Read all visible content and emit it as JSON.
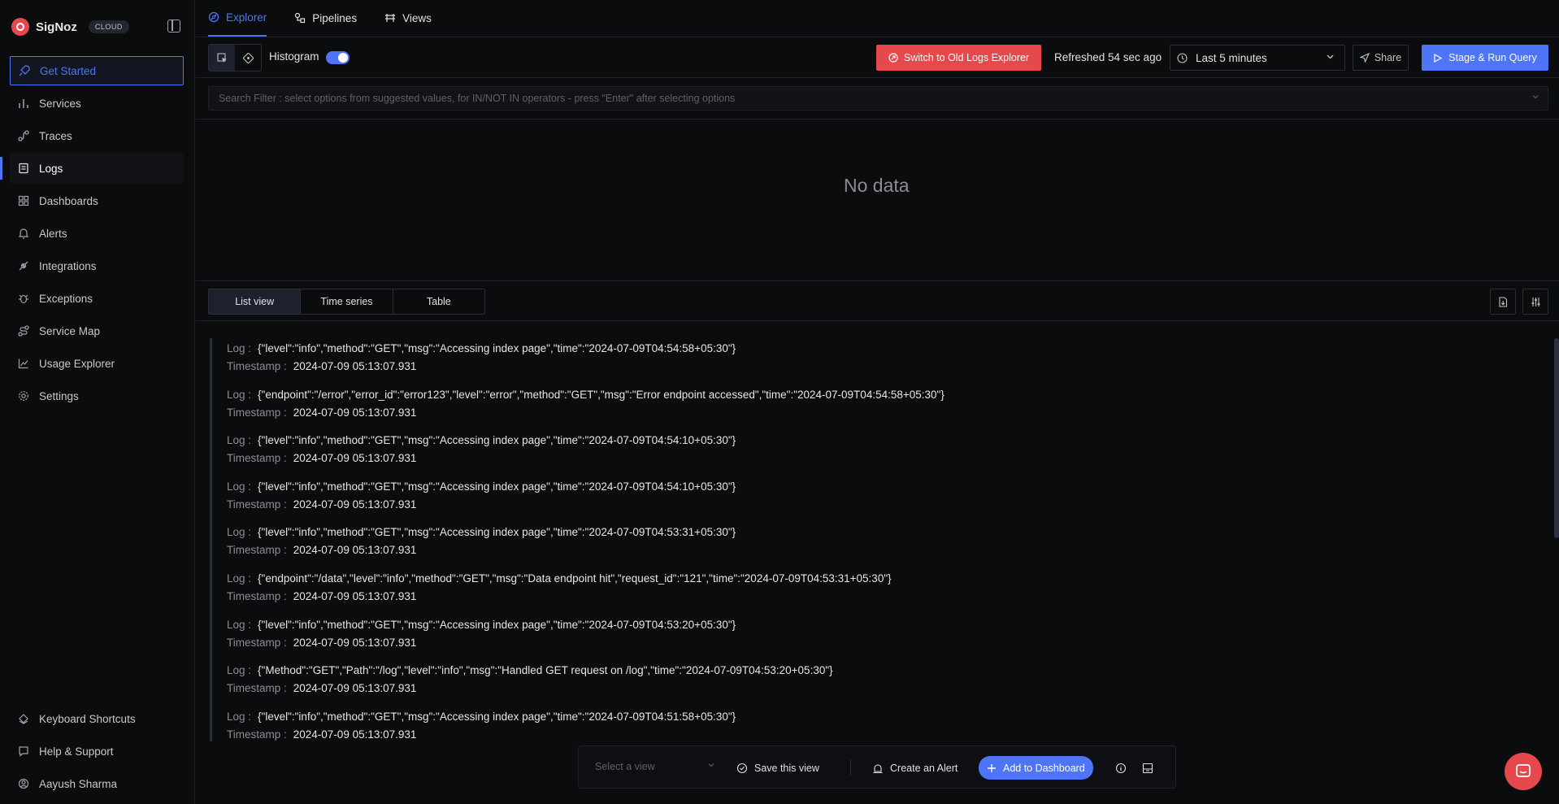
{
  "brand": {
    "name": "SigNoz",
    "badge": "CLOUD"
  },
  "sidebar": {
    "items": [
      {
        "label": "Get Started",
        "icon": "rocket-icon"
      },
      {
        "label": "Services",
        "icon": "bar-chart-icon"
      },
      {
        "label": "Traces",
        "icon": "route-icon"
      },
      {
        "label": "Logs",
        "icon": "logs-icon"
      },
      {
        "label": "Dashboards",
        "icon": "grid-icon"
      },
      {
        "label": "Alerts",
        "icon": "bell-icon"
      },
      {
        "label": "Integrations",
        "icon": "plug-icon"
      },
      {
        "label": "Exceptions",
        "icon": "bug-icon"
      },
      {
        "label": "Service Map",
        "icon": "route-icon"
      },
      {
        "label": "Usage Explorer",
        "icon": "line-chart-icon"
      },
      {
        "label": "Settings",
        "icon": "gear-icon"
      }
    ],
    "bottom": [
      {
        "label": "Keyboard Shortcuts",
        "icon": "keyboard-icon"
      },
      {
        "label": "Help & Support",
        "icon": "help-icon"
      },
      {
        "label": "Aayush Sharma",
        "icon": "user-icon"
      }
    ]
  },
  "top_tabs": [
    {
      "label": "Explorer",
      "icon": "compass-icon"
    },
    {
      "label": "Pipelines",
      "icon": "pipeline-icon"
    },
    {
      "label": "Views",
      "icon": "views-icon"
    }
  ],
  "toolbar": {
    "histogram_label": "Histogram",
    "switch_old": "Switch to Old Logs Explorer",
    "refreshed": "Refreshed 54 sec ago",
    "time_range": "Last 5 minutes",
    "share": "Share",
    "stage_run": "Stage & Run Query"
  },
  "search": {
    "placeholder": "Search Filter : select options from suggested values, for IN/NOT IN operators - press \"Enter\" after selecting options"
  },
  "histogram": {
    "empty_text": "No data"
  },
  "view_tabs": [
    "List view",
    "Time series",
    "Table"
  ],
  "logs": {
    "log_label": "Log :",
    "timestamp_label": "Timestamp :",
    "rows": [
      {
        "log": "{\"level\":\"info\",\"method\":\"GET\",\"msg\":\"Accessing index page\",\"time\":\"2024-07-09T04:54:58+05:30\"}",
        "timestamp": "2024-07-09 05:13:07.931"
      },
      {
        "log": "{\"endpoint\":\"/error\",\"error_id\":\"error123\",\"level\":\"error\",\"method\":\"GET\",\"msg\":\"Error endpoint accessed\",\"time\":\"2024-07-09T04:54:58+05:30\"}",
        "timestamp": "2024-07-09 05:13:07.931"
      },
      {
        "log": "{\"level\":\"info\",\"method\":\"GET\",\"msg\":\"Accessing index page\",\"time\":\"2024-07-09T04:54:10+05:30\"}",
        "timestamp": "2024-07-09 05:13:07.931"
      },
      {
        "log": "{\"level\":\"info\",\"method\":\"GET\",\"msg\":\"Accessing index page\",\"time\":\"2024-07-09T04:54:10+05:30\"}",
        "timestamp": "2024-07-09 05:13:07.931"
      },
      {
        "log": "{\"level\":\"info\",\"method\":\"GET\",\"msg\":\"Accessing index page\",\"time\":\"2024-07-09T04:53:31+05:30\"}",
        "timestamp": "2024-07-09 05:13:07.931"
      },
      {
        "log": "{\"endpoint\":\"/data\",\"level\":\"info\",\"method\":\"GET\",\"msg\":\"Data endpoint hit\",\"request_id\":\"121\",\"time\":\"2024-07-09T04:53:31+05:30\"}",
        "timestamp": "2024-07-09 05:13:07.931"
      },
      {
        "log": "{\"level\":\"info\",\"method\":\"GET\",\"msg\":\"Accessing index page\",\"time\":\"2024-07-09T04:53:20+05:30\"}",
        "timestamp": "2024-07-09 05:13:07.931"
      },
      {
        "log": "{\"Method\":\"GET\",\"Path\":\"/log\",\"level\":\"info\",\"msg\":\"Handled GET request on /log\",\"time\":\"2024-07-09T04:53:20+05:30\"}",
        "timestamp": "2024-07-09 05:13:07.931"
      },
      {
        "log": "{\"level\":\"info\",\"method\":\"GET\",\"msg\":\"Accessing index page\",\"time\":\"2024-07-09T04:51:58+05:30\"}",
        "timestamp": "2024-07-09 05:13:07.931"
      }
    ]
  },
  "bottom_bar": {
    "select_view": "Select a view",
    "save_view": "Save this view",
    "create_alert": "Create an Alert",
    "add_dashboard": "Add to Dashboard"
  },
  "colors": {
    "accent": "#4e74f8",
    "danger": "#e5484d",
    "background": "#0b0c0e"
  }
}
